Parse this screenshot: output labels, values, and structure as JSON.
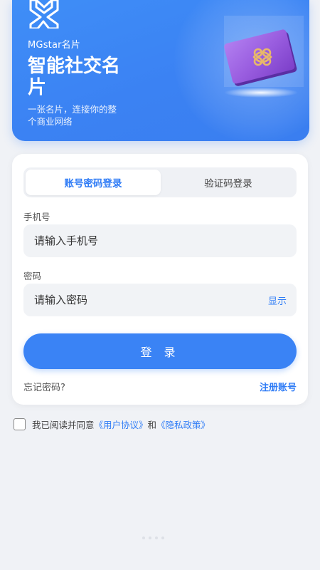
{
  "header": {
    "brand": "MGstar名片",
    "headline": "智能社交名片",
    "tagline": "一张名片，连接你的整个商业网络"
  },
  "login": {
    "tabs": [
      {
        "label": "账号密码登录",
        "active": true
      },
      {
        "label": "验证码登录",
        "active": false
      }
    ],
    "phone_label": "手机号",
    "phone_placeholder": "请输入手机号",
    "password_label": "密码",
    "password_placeholder": "请输入密码",
    "show_label": "显示",
    "submit_label": "登 录",
    "forgot_label": "忘记密码?",
    "register_label": "注册账号"
  },
  "agreement": {
    "checked": false,
    "prefix": "我已阅读并同意",
    "terms_link": "《用户协议》",
    "and": "和",
    "privacy_link": "《隐私政策》"
  },
  "colors": {
    "accent": "#3a83f5",
    "header": "#3b82f3",
    "background": "#f0f2f6"
  },
  "pager": {
    "count": 4,
    "active_index": 0
  }
}
